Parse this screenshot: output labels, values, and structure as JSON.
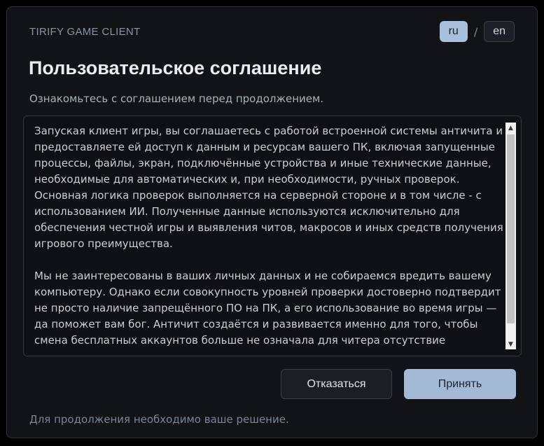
{
  "app": {
    "title": "TIRIFY GAME CLIENT"
  },
  "language": {
    "options": [
      "ru",
      "en"
    ],
    "selected": "ru",
    "separator": "/"
  },
  "dialog": {
    "title": "Пользовательское соглашение",
    "subtitle": "Ознакомьтесь с соглашением перед продолжением.",
    "agreement_text": "Запуская клиент игры, вы соглашаетесь с работой встроенной системы античита и предоставляете ей доступ к данным и ресурсам вашего ПК, включая запущенные процессы, файлы, экран, подключённые устройства и иные технические данные, необходимые для автоматических и, при необходимости, ручных проверок. Основная логика проверок выполняется на серверной стороне и в том числе - с использованием ИИ. Полученные данные используются исключительно для обеспечения честной игры и выявления читов, макросов и иных средств получения игрового преимущества.\n\nМы не заинтересованы в ваших личных данных и не собираемся вредить вашему компьютеру. Однако если совокупность уровней проверки достоверно подтвердит не просто наличие запрещённого ПО на ПК, а его использование во время игры — да поможет вам бог. Античит создаётся и развивается именно для того, чтобы смена бесплатных аккаунтов больше не означала для читера отсутствие",
    "decline_label": "Отказаться",
    "accept_label": "Принять",
    "footer_note": "Для продолжения необходимо ваше решение."
  },
  "scrollbar": {
    "up_arrow": "▲",
    "down_arrow": "▼"
  },
  "colors": {
    "background": "#121316",
    "accent": "#a2bad6",
    "text": "#c9ced6",
    "muted": "#7b8594"
  }
}
